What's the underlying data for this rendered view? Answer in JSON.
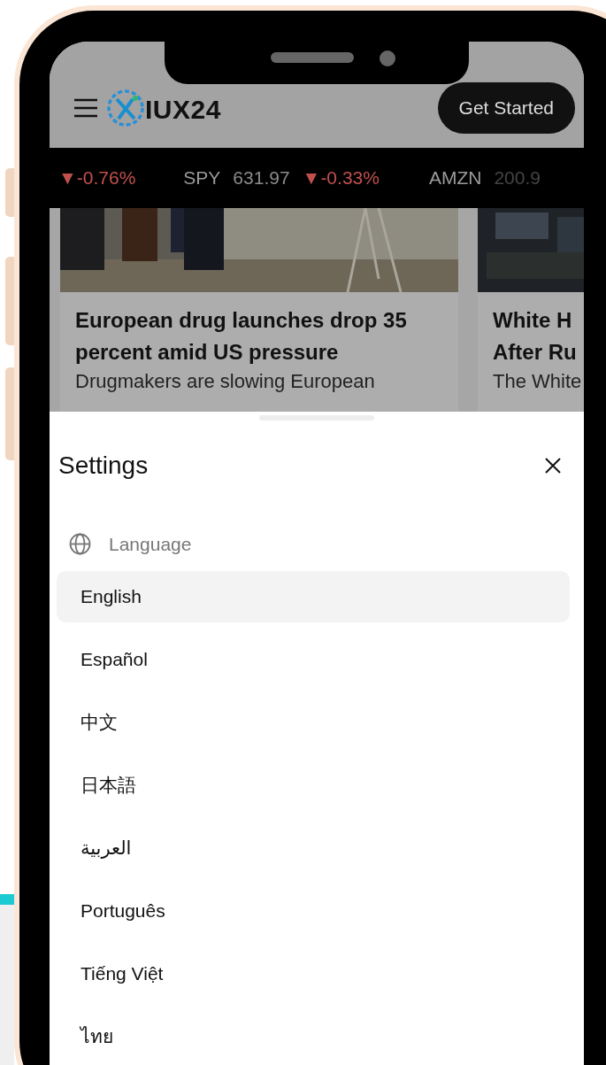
{
  "header": {
    "logo_text": "IUX24",
    "cta": "Get Started"
  },
  "ticker": [
    {
      "change": "▼-0.76%"
    },
    {
      "symbol": "SPY",
      "price": "631.97",
      "change": "▼-0.33%"
    },
    {
      "symbol": "AMZN",
      "price": "200.9"
    }
  ],
  "cards": [
    {
      "title_lines": [
        "European drug launches drop 35",
        "percent amid US pressure"
      ],
      "summary": "Drugmakers are slowing European"
    },
    {
      "title_lines": [
        "White H",
        "After Ru"
      ],
      "summary": "The White"
    }
  ],
  "settings": {
    "title": "Settings",
    "section": "Language",
    "languages": [
      {
        "label": "English",
        "selected": true
      },
      {
        "label": "Español",
        "selected": false
      },
      {
        "label": "中文",
        "selected": false
      },
      {
        "label": "日本語",
        "selected": false
      },
      {
        "label": "العربية",
        "selected": false
      },
      {
        "label": "Português",
        "selected": false
      },
      {
        "label": "Tiếng Việt",
        "selected": false
      },
      {
        "label": "ไทย",
        "selected": false
      }
    ]
  }
}
